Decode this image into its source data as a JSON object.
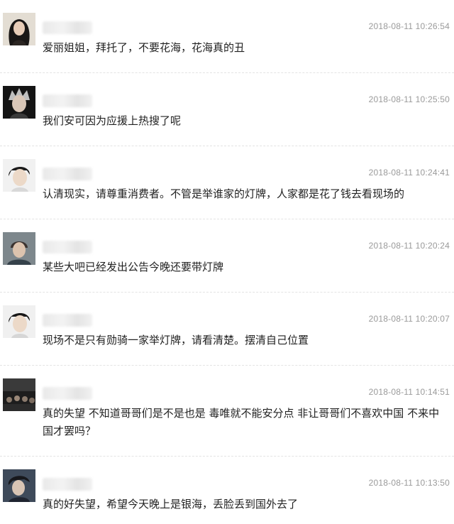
{
  "comments": [
    {
      "avatar_icon": "user-avatar-icon",
      "timestamp": "2018-08-11 10:26:54",
      "text": "爱丽姐姐，拜托了，不要花海，花海真的丑"
    },
    {
      "avatar_icon": "user-avatar-icon",
      "timestamp": "2018-08-11 10:25:50",
      "text": "我们安可因为应援上热搜了呢"
    },
    {
      "avatar_icon": "user-avatar-icon",
      "timestamp": "2018-08-11 10:24:41",
      "text": "认清现实，请尊重消费者。不管是举谁家的灯牌，人家都是花了钱去看现场的"
    },
    {
      "avatar_icon": "user-avatar-icon",
      "timestamp": "2018-08-11 10:20:24",
      "text": "某些大吧已经发出公告今晚还要带灯牌"
    },
    {
      "avatar_icon": "user-avatar-icon",
      "timestamp": "2018-08-11 10:20:07",
      "text": "现场不是只有勋骑一家举灯牌，请看清楚。摆清自己位置"
    },
    {
      "avatar_icon": "user-avatar-icon",
      "timestamp": "2018-08-11 10:14:51",
      "text": "真的失望 不知道哥哥们是不是也是 毒唯就不能安分点 非让哥哥们不喜欢中国 不来中国才罢吗？"
    },
    {
      "avatar_icon": "user-avatar-icon",
      "timestamp": "2018-08-11 10:13:50",
      "text": "真的好失望，希望今天晚上是银海，丢脸丢到国外去了"
    }
  ]
}
